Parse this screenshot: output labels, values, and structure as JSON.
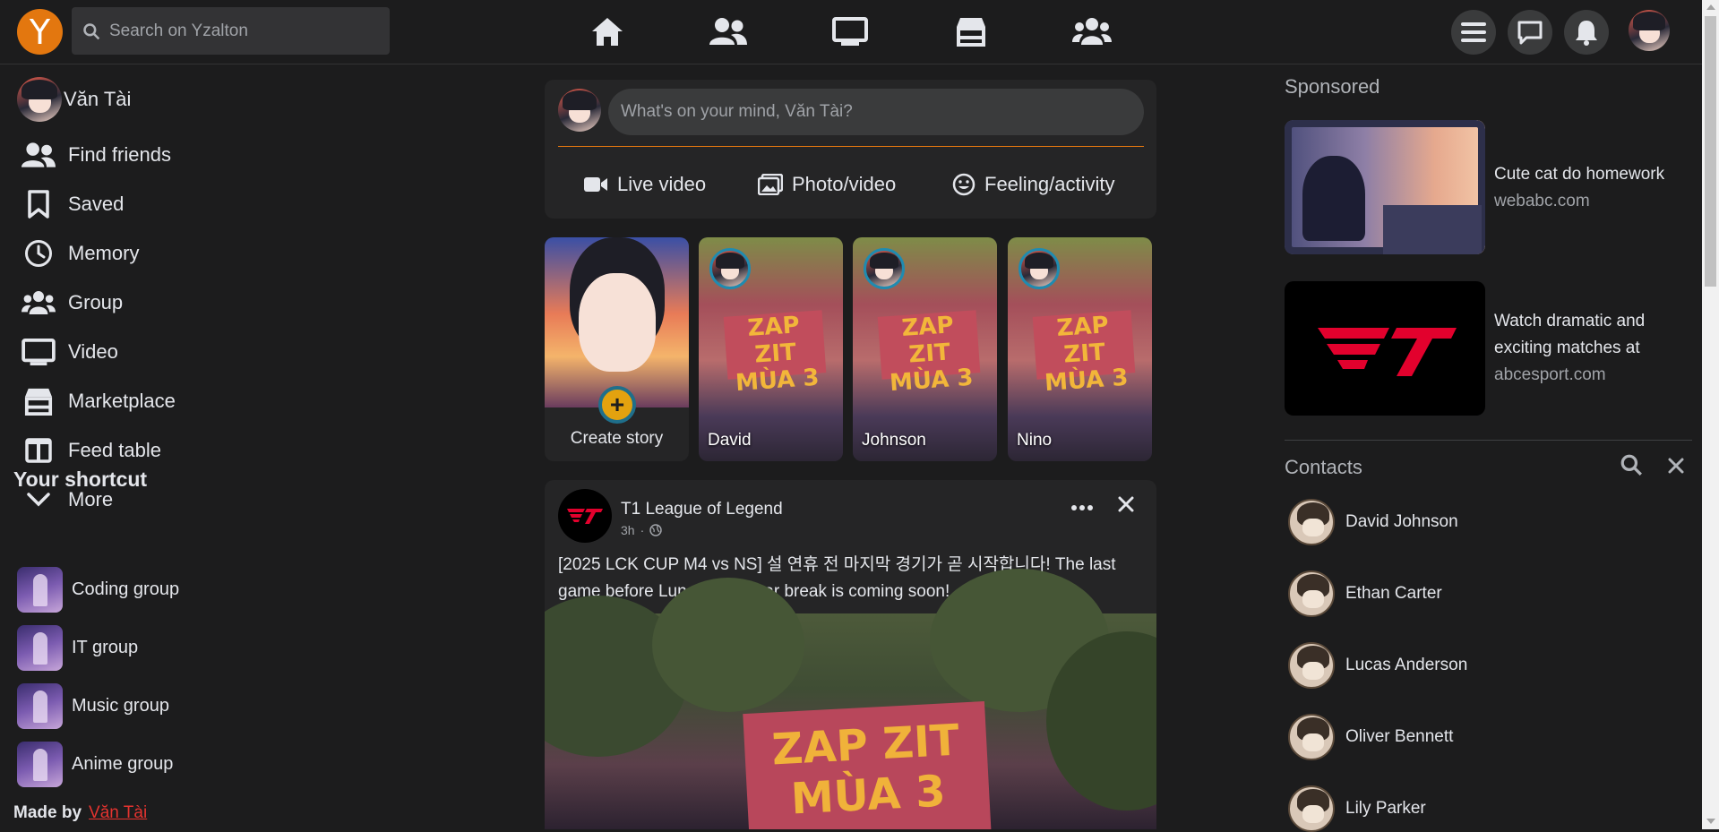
{
  "app": {
    "logo_letter": "Y",
    "brand_color": "#e3770f"
  },
  "search": {
    "placeholder": "Search on Yzalton"
  },
  "top_nav": [
    "home-icon",
    "friends-icon",
    "video-icon",
    "marketplace-icon",
    "groups-icon"
  ],
  "top_right": [
    "menu-icon",
    "messenger-icon",
    "notifications-icon",
    "profile-avatar"
  ],
  "user": {
    "name": "Văn Tài"
  },
  "left_menu": [
    {
      "label": "Find friends",
      "icon": "friends-icon"
    },
    {
      "label": "Saved",
      "icon": "bookmark-icon"
    },
    {
      "label": "Memory",
      "icon": "clock-icon"
    },
    {
      "label": "Group",
      "icon": "group-icon"
    },
    {
      "label": "Video",
      "icon": "video-icon"
    },
    {
      "label": "Marketplace",
      "icon": "store-icon"
    },
    {
      "label": "Feed table",
      "icon": "columns-icon"
    },
    {
      "label": "More",
      "icon": "chevron-down-icon"
    }
  ],
  "shortcuts": {
    "title": "Your shortcut",
    "items": [
      "Coding group",
      "IT group",
      "Music group",
      "Anime group"
    ]
  },
  "footer": {
    "made_by": "Made by",
    "author": "Văn Tài"
  },
  "composer": {
    "placeholder": "What's on your mind, Văn Tài?",
    "live": "Live video",
    "photo": "Photo/video",
    "feeling": "Feeling/activity"
  },
  "stories": {
    "create": "Create story",
    "items": [
      "David",
      "Johnson",
      "Nino"
    ],
    "banner": "ZAP ZIT MÙA 3"
  },
  "post": {
    "author": "T1 League of Legend",
    "time": "3h",
    "text": "[2025 LCK CUP M4 vs NS] 설 연휴 전 마지막 경기가 곧 시작합니다! The last game before Lunar New Year break is coming soon!",
    "image_banner": "ZAP ZIT MÙA 3"
  },
  "sponsored": {
    "title": "Sponsored",
    "ads": [
      {
        "title": "Cute cat do homework",
        "site": "webabc.com"
      },
      {
        "title": "Watch dramatic and exciting matches at",
        "site": "abcesport.com"
      }
    ]
  },
  "contacts": {
    "title": "Contacts",
    "items": [
      "David Johnson",
      "Ethan Carter",
      "Lucas Anderson",
      "Oliver Bennett",
      "Lily Parker"
    ]
  }
}
